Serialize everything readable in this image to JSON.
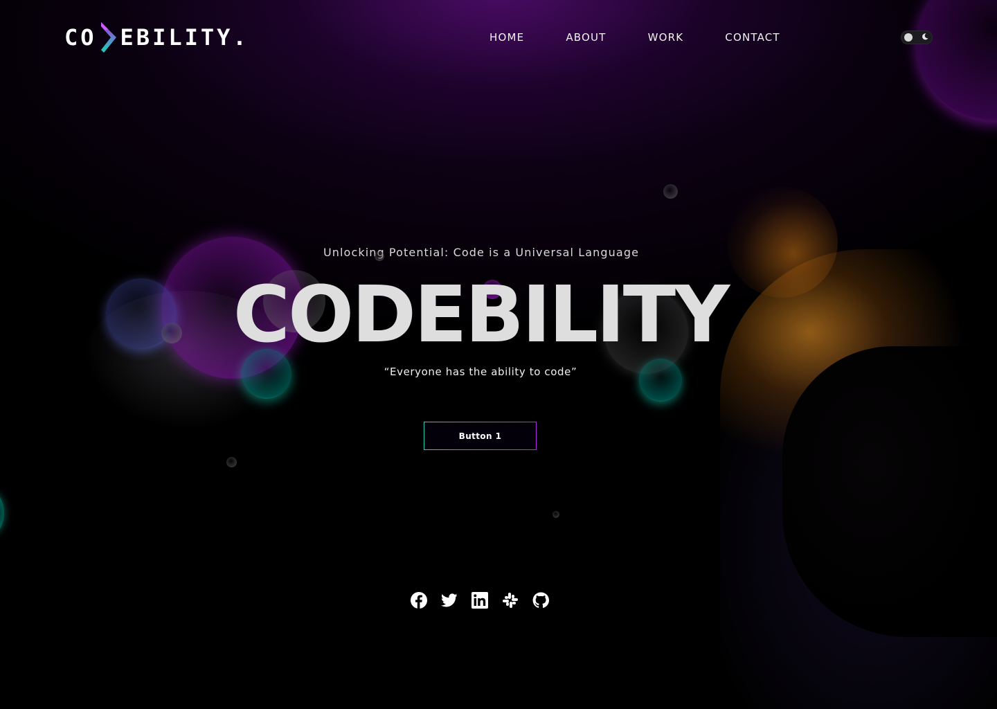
{
  "brand": {
    "logo_left": "CO",
    "logo_right": "EBILITY.",
    "mark_colors": [
      "#b02ae6",
      "#18d6b6"
    ]
  },
  "nav": {
    "items": [
      {
        "label": "HOME"
      },
      {
        "label": "ABOUT"
      },
      {
        "label": "WORK"
      },
      {
        "label": "CONTACT"
      }
    ]
  },
  "theme_toggle": {
    "icon": "moon-icon",
    "state": "dark"
  },
  "hero": {
    "subtitle": "Unlocking Potential: Code is a Universal Language",
    "title": "CODEBILITY",
    "quote": "“Everyone has the ability to code”",
    "cta_label": "Button 1"
  },
  "socials": [
    {
      "icon": "facebook-icon"
    },
    {
      "icon": "twitter-icon"
    },
    {
      "icon": "linkedin-icon"
    },
    {
      "icon": "slack-icon"
    },
    {
      "icon": "github-icon"
    }
  ],
  "colors": {
    "accent_purple": "#b02ae6",
    "accent_teal": "#18d6b6",
    "background": "#000000",
    "title_grey": "#dedede"
  }
}
